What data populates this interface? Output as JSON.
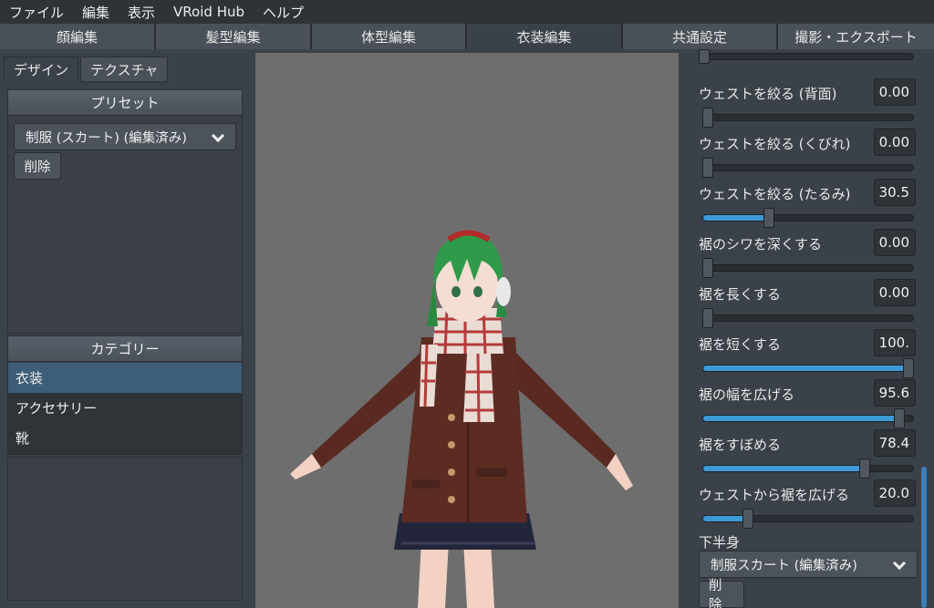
{
  "menu": [
    "ファイル",
    "編集",
    "表示",
    "VRoid Hub",
    "ヘルプ"
  ],
  "tabs": [
    {
      "label": "顔編集",
      "active": false
    },
    {
      "label": "髪型編集",
      "active": false
    },
    {
      "label": "体型編集",
      "active": false
    },
    {
      "label": "衣装編集",
      "active": true
    },
    {
      "label": "共通設定",
      "active": false
    },
    {
      "label": "撮影・エクスポート",
      "active": false
    }
  ],
  "left": {
    "subtabs": [
      "デザイン",
      "テクスチャ"
    ],
    "preset_header": "プリセット",
    "preset_selected": "制服 (スカート) (編集済み)",
    "delete_label": "削除",
    "category_header": "カテゴリー",
    "categories": [
      "衣装",
      "アクセサリー",
      "靴"
    ]
  },
  "right": {
    "sliders": [
      {
        "label": "ウェストを絞る (背面)",
        "value": "0.00",
        "level": 0
      },
      {
        "label": "ウェストを絞る (くびれ)",
        "value": "0.00",
        "level": 0
      },
      {
        "label": "ウェストを絞る (たるみ)",
        "value": "30.5",
        "level": 0.305
      },
      {
        "label": "裾のシワを深くする",
        "value": "0.00",
        "level": 0
      },
      {
        "label": "裾を長くする",
        "value": "0.00",
        "level": 0
      },
      {
        "label": "裾を短くする",
        "value": "100.",
        "level": 1.0
      },
      {
        "label": "裾の幅を広げる",
        "value": "95.6",
        "level": 0.956
      },
      {
        "label": "裾をすぼめる",
        "value": "78.4",
        "level": 0.784
      },
      {
        "label": "ウェストから裾を広げる",
        "value": "20.0",
        "level": 0.2
      }
    ],
    "lower_body_label": "下半身",
    "lower_body_selected": "制服スカート (編集済み)",
    "delete_label": "削除"
  },
  "colors": {
    "accent": "#3d9ad6",
    "selection": "#3e5d78",
    "viewport_bg": "#6e6e6e"
  }
}
